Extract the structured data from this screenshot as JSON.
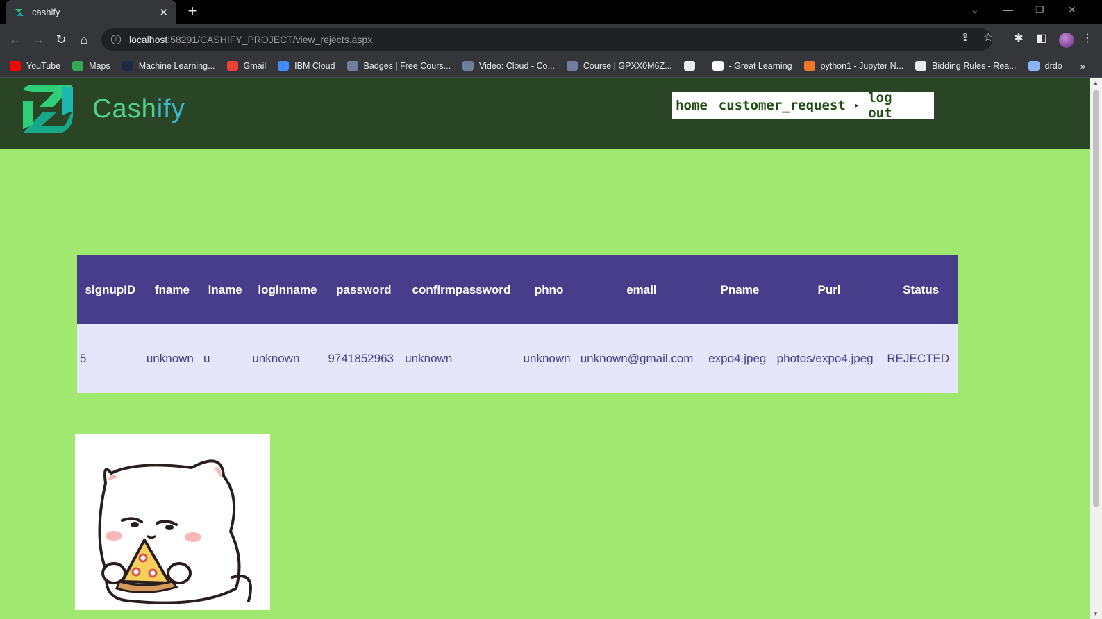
{
  "browser": {
    "tab_title": "cashify",
    "url_host": "localhost",
    "url_path": ":58291/CASHIFY_PROJECT/view_rejects.aspx",
    "bookmarks": [
      {
        "label": "YouTube",
        "color": "#ff0000"
      },
      {
        "label": "Maps",
        "color": "#34a853"
      },
      {
        "label": "Machine Learning...",
        "color": "#1f2a44"
      },
      {
        "label": "Gmail",
        "color": "#ea4335"
      },
      {
        "label": "IBM Cloud",
        "color": "#4589ff"
      },
      {
        "label": "Badges | Free Cours...",
        "color": "#6f7f99"
      },
      {
        "label": "Video: Cloud - Co...",
        "color": "#6f7f99"
      },
      {
        "label": "Course | GPXX0M6Z...",
        "color": "#6f7f99"
      },
      {
        "label": "",
        "color": "#e8eaed"
      },
      {
        "label": "- Great Learning",
        "color": "#ffffff"
      },
      {
        "label": "python1 - Jupyter N...",
        "color": "#f37626"
      },
      {
        "label": "Bidding Rules - Rea...",
        "color": "#e8eaed"
      },
      {
        "label": "drdo",
        "color": "#8ab4f8"
      }
    ],
    "bookmarks_more": "»"
  },
  "site": {
    "brand_part1": "Cash",
    "brand_part2": "ify",
    "menu": {
      "home": "home",
      "customer_request": "customer_request",
      "arrow": "▸",
      "logout": "log out"
    }
  },
  "table": {
    "headers": [
      "signupID",
      "fname",
      "lname",
      "loginname",
      "password",
      "confirmpassword",
      "phno",
      "email",
      "Pname",
      "Purl",
      "Status"
    ],
    "rows": [
      [
        "5",
        "unknown",
        "u",
        "unknown",
        "9741852963",
        "unknown",
        "unknown",
        "unknown@gmail.com",
        "expo4.jpeg",
        "photos/expo4.jpeg",
        "REJECTED"
      ]
    ]
  },
  "colors": {
    "page_bg": "#a0e870",
    "header_bg": "#2a4526",
    "table_header_bg": "#483d8b",
    "table_row_bg": "#e6e6fa"
  }
}
